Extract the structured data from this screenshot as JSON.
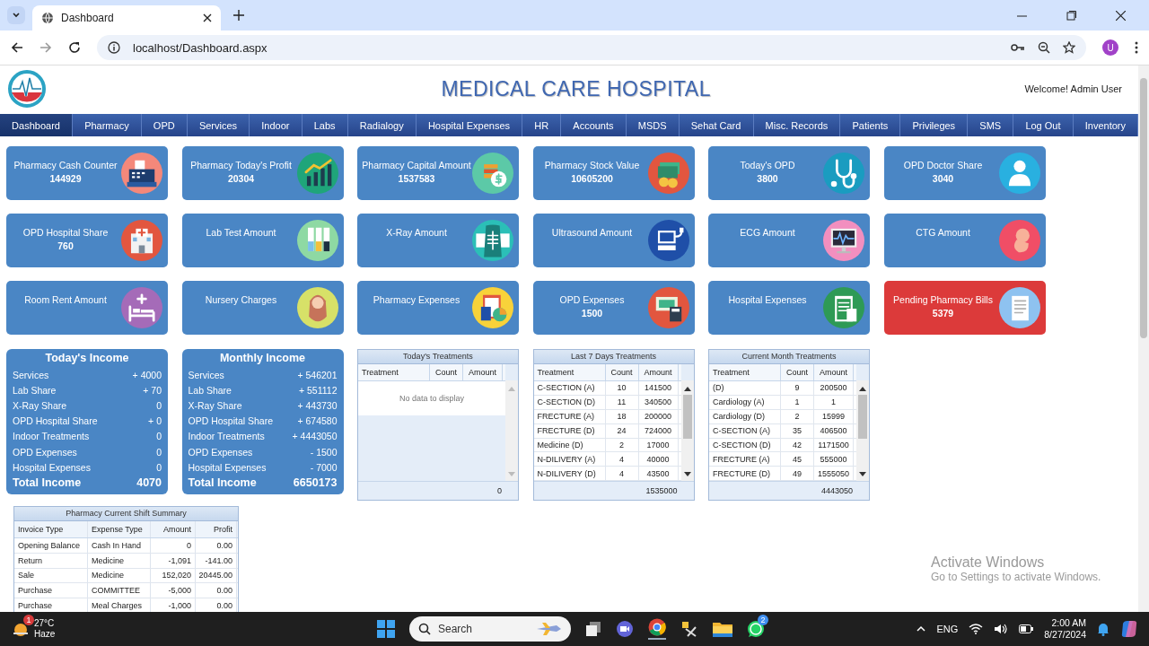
{
  "browser": {
    "tab_title": "Dashboard",
    "url": "localhost/Dashboard.aspx",
    "profile_initial": "U"
  },
  "header": {
    "title": "MEDICAL CARE HOSPITAL",
    "welcome": "Welcome! Admin User"
  },
  "nav": [
    {
      "label": "Dashboard",
      "selected": true
    },
    {
      "label": "Pharmacy",
      "selected": false
    },
    {
      "label": "OPD",
      "selected": false
    },
    {
      "label": "Services",
      "selected": false
    },
    {
      "label": "Indoor",
      "selected": false
    },
    {
      "label": "Labs",
      "selected": false
    },
    {
      "label": "Radialogy",
      "selected": false
    },
    {
      "label": "Hospital Expenses",
      "selected": false
    },
    {
      "label": "HR",
      "selected": false
    },
    {
      "label": "Accounts",
      "selected": false
    },
    {
      "label": "MSDS",
      "selected": false
    },
    {
      "label": "Sehat Card",
      "selected": false
    },
    {
      "label": "Misc. Records",
      "selected": false
    },
    {
      "label": "Patients",
      "selected": false
    },
    {
      "label": "Privileges",
      "selected": false
    },
    {
      "label": "SMS",
      "selected": false
    },
    {
      "label": "Log Out",
      "selected": false
    },
    {
      "label": "Inventory",
      "selected": false
    }
  ],
  "cards": [
    {
      "label": "Pharmacy Cash Counter",
      "value": "144929",
      "color": "#4a86c5"
    },
    {
      "label": "Pharmacy Today's Profit",
      "value": "20304",
      "color": "#4a86c5"
    },
    {
      "label": "Pharmacy Capital Amount",
      "value": "1537583",
      "color": "#4a86c5"
    },
    {
      "label": "Pharmacy Stock Value",
      "value": "10605200",
      "color": "#4a86c5"
    },
    {
      "label": "Today's OPD",
      "value": "3800",
      "color": "#4a86c5"
    },
    {
      "label": "OPD Doctor Share",
      "value": "3040",
      "color": "#4a86c5"
    },
    {
      "label": "OPD Hospital Share",
      "value": "760",
      "color": "#4a86c5"
    },
    {
      "label": "Lab Test Amount",
      "color": "#4a86c5"
    },
    {
      "label": "X-Ray Amount",
      "color": "#4a86c5"
    },
    {
      "label": "Ultrasound Amount",
      "color": "#4a86c5"
    },
    {
      "label": "ECG Amount",
      "color": "#4a86c5"
    },
    {
      "label": "CTG Amount",
      "color": "#4a86c5"
    },
    {
      "label": "Room Rent Amount",
      "color": "#4a86c5"
    },
    {
      "label": "Nursery Charges",
      "color": "#4a86c5"
    },
    {
      "label": "Pharmacy Expenses",
      "color": "#4a86c5"
    },
    {
      "label": "OPD Expenses",
      "value": "1500",
      "color": "#4a86c5"
    },
    {
      "label": "Hospital Expenses",
      "color": "#4a86c5"
    },
    {
      "label": "Pending Pharmacy Bills",
      "value": "5379",
      "color": "#dc3a3a"
    }
  ],
  "income_panels": [
    {
      "title": "Today's Income",
      "rows": [
        {
          "label": "Services",
          "value": "+ 4000"
        },
        {
          "label": "Lab Share",
          "value": "+ 70"
        },
        {
          "label": "X-Ray Share",
          "value": "0"
        },
        {
          "label": "OPD Hospital Share",
          "value": "+ 0"
        },
        {
          "label": "Indoor Treatments",
          "value": "0"
        },
        {
          "label": "OPD Expenses",
          "value": "0"
        },
        {
          "label": "Hospital Expenses",
          "value": "0"
        }
      ],
      "total_label": "Total Income",
      "total": "4070"
    },
    {
      "title": "Monthly Income",
      "rows": [
        {
          "label": "Services",
          "value": "+ 546201"
        },
        {
          "label": "Lab Share",
          "value": "+ 551112"
        },
        {
          "label": "X-Ray Share",
          "value": "+ 443730"
        },
        {
          "label": "OPD Hospital Share",
          "value": "+ 674580"
        },
        {
          "label": "Indoor Treatments",
          "value": "+ 4443050"
        },
        {
          "label": "OPD Expenses",
          "value": "- 1500"
        },
        {
          "label": "Hospital Expenses",
          "value": "- 7000"
        }
      ],
      "total_label": "Total Income",
      "total": "6650173"
    }
  ],
  "treatment_tables": [
    {
      "title": "Today's Treatments",
      "columns": [
        "Treatment",
        "Count",
        "Amount"
      ],
      "empty_message": "No data to display",
      "total": "0"
    },
    {
      "title": "Last 7 Days Treatments",
      "columns": [
        "Treatment",
        "Count",
        "Amount"
      ],
      "rows": [
        [
          "C-SECTION (A)",
          "10",
          "141500"
        ],
        [
          "C-SECTION (D)",
          "11",
          "340500"
        ],
        [
          "FRECTURE (A)",
          "18",
          "200000"
        ],
        [
          "FRECTURE (D)",
          "24",
          "724000"
        ],
        [
          "Medicine (D)",
          "2",
          "17000"
        ],
        [
          "N-DILIVERY (A)",
          "4",
          "40000"
        ],
        [
          "N-DILIVERY (D)",
          "4",
          "43500"
        ]
      ],
      "total": "1535000"
    },
    {
      "title": "Current Month Treatments",
      "columns": [
        "Treatment",
        "Count",
        "Amount"
      ],
      "rows": [
        [
          "(D)",
          "9",
          "200500"
        ],
        [
          "Cardiology (A)",
          "1",
          "1"
        ],
        [
          "Cardiology (D)",
          "2",
          "15999"
        ],
        [
          "C-SECTION (A)",
          "35",
          "406500"
        ],
        [
          "C-SECTION (D)",
          "42",
          "1171500"
        ],
        [
          "FRECTURE (A)",
          "45",
          "555000"
        ],
        [
          "FRECTURE (D)",
          "49",
          "1555050"
        ]
      ],
      "total": "4443050"
    }
  ],
  "shift_summary": {
    "title": "Pharmacy Current Shift Summary",
    "columns": [
      "Invoice Type",
      "Expense Type",
      "Amount",
      "Profit"
    ],
    "rows": [
      [
        "Opening Balance",
        "Cash In Hand",
        "0",
        "0.00"
      ],
      [
        "Return",
        "Medicine",
        "-1,091",
        "-141.00"
      ],
      [
        "Sale",
        "Medicine",
        "152,020",
        "20445.00"
      ],
      [
        "Purchase",
        "COMMITTEE",
        "-5,000",
        "0.00"
      ],
      [
        "Purchase",
        "Meal Charges",
        "-1,000",
        "0.00"
      ]
    ]
  },
  "activation_notice": {
    "title": "Activate Windows",
    "hint": "Go to Settings to activate Windows."
  },
  "taskbar": {
    "weather_badge": "1",
    "temperature": "27°C",
    "weather": "Haze",
    "search_placeholder": "Search",
    "whatsapp_badge": "2",
    "language": "ENG",
    "time": "2:00 AM",
    "date": "8/27/2024"
  }
}
